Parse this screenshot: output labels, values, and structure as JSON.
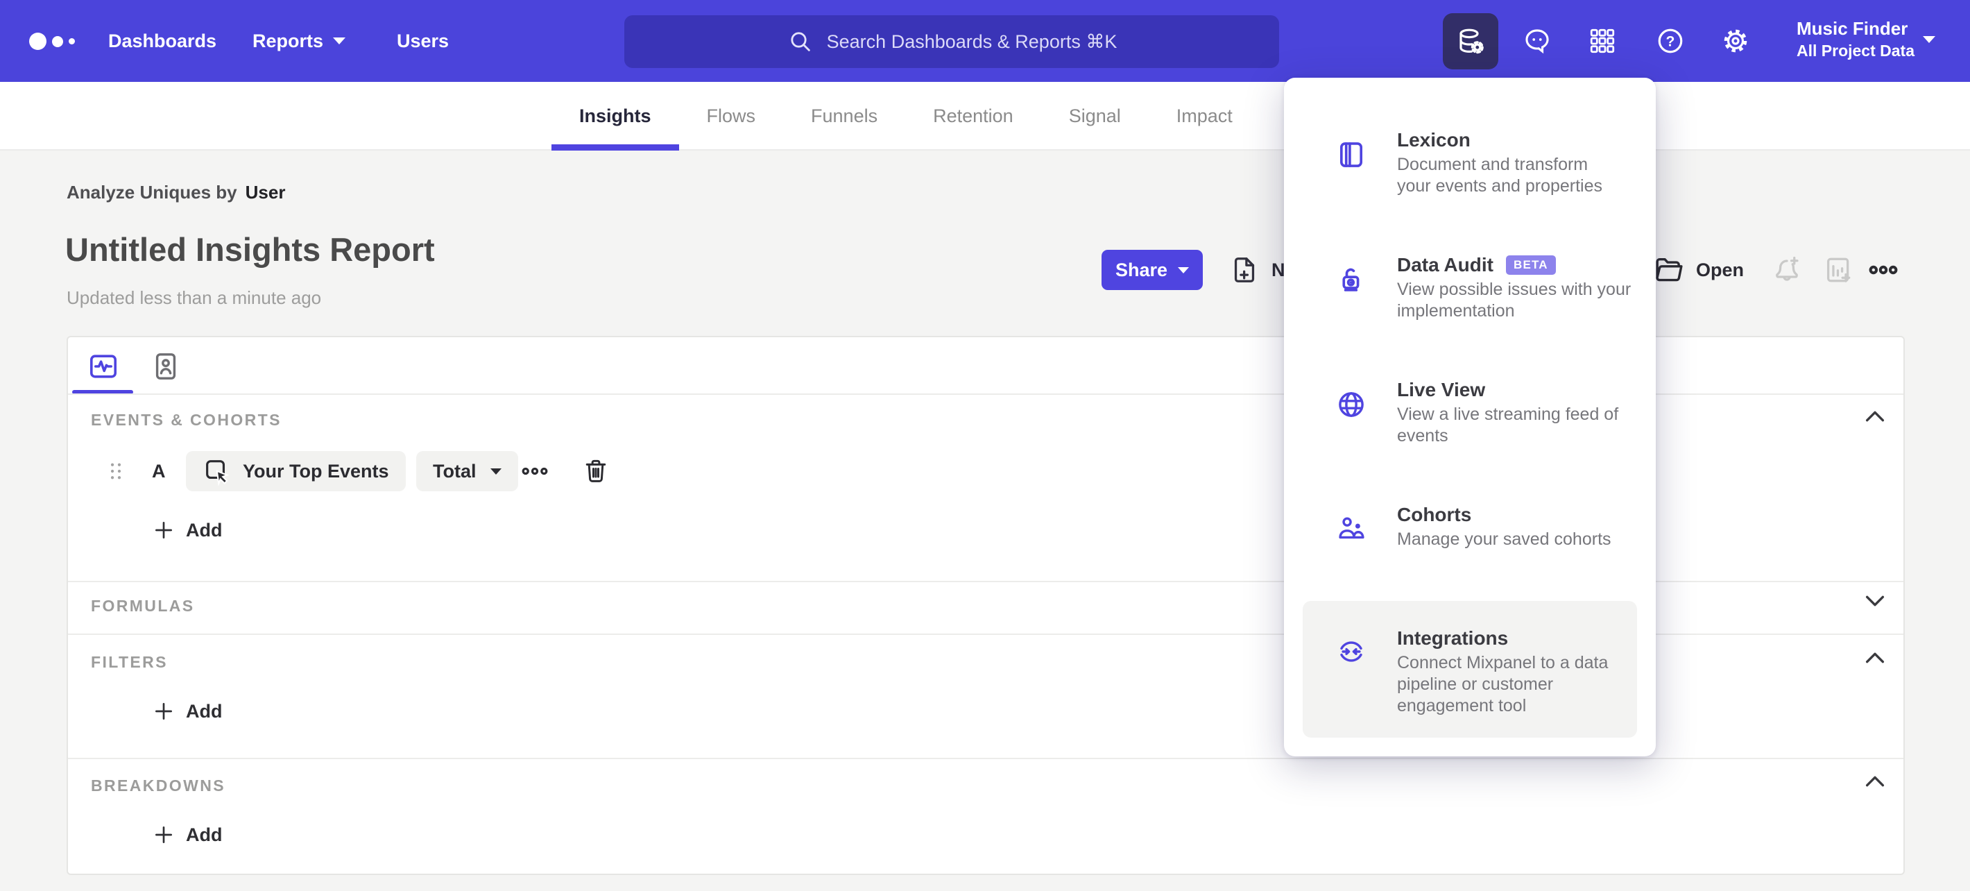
{
  "nav": {
    "items": [
      "Dashboards",
      "Reports",
      "Users"
    ],
    "search": {
      "placeholder": "Search Dashboards & Reports ⌘K"
    },
    "project_name": "Music Finder",
    "project_scope": "All Project Data",
    "icons": [
      "data-management-icon",
      "feedback-chat-icon",
      "apps-grid-icon",
      "help-icon",
      "settings-gear-icon"
    ]
  },
  "tabs": [
    "Insights",
    "Flows",
    "Funnels",
    "Retention",
    "Signal",
    "Impact"
  ],
  "active_tab": "Insights",
  "report": {
    "analyze_by_prefix": "Analyze Uniques by",
    "analyze_by_value": "User",
    "title": "Untitled Insights Report",
    "updated": "Updated less than a minute ago",
    "share": "Share",
    "new": "New",
    "open": "Open"
  },
  "builder": {
    "events_title": "EVENTS & COHORTS",
    "event_row": {
      "label": "A",
      "event": "Your Top Events",
      "aggregation": "Total"
    },
    "events_add": "Add",
    "formulas_title": "FORMULAS",
    "filters_title": "FILTERS",
    "filters_add": "Add",
    "breakdowns_title": "BREAKDOWNS",
    "breakdowns_add": "Add"
  },
  "menu": {
    "items": [
      {
        "icon": "book-icon",
        "title": "Lexicon",
        "description": "Document and transform your events and properties"
      },
      {
        "icon": "lock-icon",
        "title": "Data Audit",
        "badge": "BETA",
        "description": "View possible issues with your implementation"
      },
      {
        "icon": "globe-icon",
        "title": "Live View",
        "description": "View a live streaming feed of events"
      },
      {
        "icon": "people-icon",
        "title": "Cohorts",
        "description": "Manage your saved cohorts"
      },
      {
        "icon": "sync-icon",
        "title": "Integrations",
        "description": "Connect Mixpanel to a data pipeline or customer engagement tool"
      }
    ]
  },
  "colors": {
    "brand_purple": "#4f44e0",
    "nav_bg": "#4b44db",
    "nav_active_tile": "#322e68",
    "page_bg": "#f4f4f3",
    "beta_badge": "#8d83ec"
  }
}
